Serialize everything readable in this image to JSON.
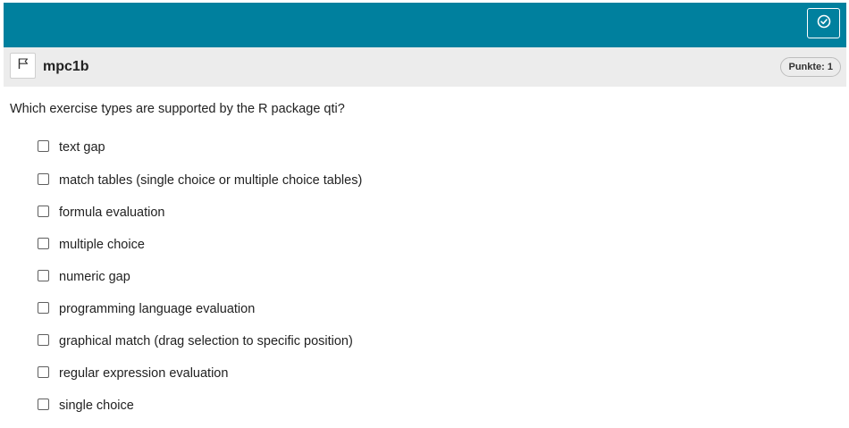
{
  "header": {
    "title": "mpc1b",
    "points_label": "Punkte: 1"
  },
  "question": {
    "text": "Which exercise types are supported by the R package qti?"
  },
  "choices": [
    {
      "label": "text gap",
      "checked": false
    },
    {
      "label": "match tables (single choice or multiple choice tables)",
      "checked": false
    },
    {
      "label": "formula evaluation",
      "checked": false
    },
    {
      "label": "multiple choice",
      "checked": false
    },
    {
      "label": "numeric gap",
      "checked": false
    },
    {
      "label": "programming language evaluation",
      "checked": false
    },
    {
      "label": "graphical match (drag selection to specific position)",
      "checked": false
    },
    {
      "label": "regular expression evaluation",
      "checked": false
    },
    {
      "label": "single choice",
      "checked": false
    }
  ],
  "icons": {
    "submit": "check-circle-icon",
    "flag": "flag-icon"
  },
  "colors": {
    "topbar": "#00809e",
    "header_bg": "#ececec"
  }
}
